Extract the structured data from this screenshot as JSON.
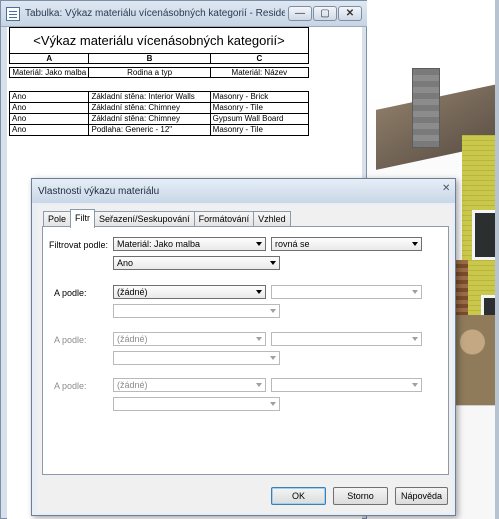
{
  "schedule_window": {
    "title": "Tabulka: Výkaz materiálu vícenásobných kategorií - Residential_...",
    "min_label": "—",
    "max_label": "▢",
    "close_label": "✕",
    "sheet_title": "<Výkaz materiálu vícenásobných kategorií>",
    "col_letters": [
      "A",
      "B",
      "C"
    ],
    "col_headers": [
      "Materiál: Jako malba",
      "Rodina a typ",
      "Materiál: Název"
    ],
    "rows": [
      [
        "Ano",
        "Základní stěna: Interior Walls",
        "Masonry - Brick"
      ],
      [
        "Ano",
        "Základní stěna: Chimney",
        "Masonry - Tile"
      ],
      [
        "Ano",
        "Základní stěna: Chimney",
        "Gypsum Wall Board"
      ],
      [
        "Ano",
        "Podlaha: Generic - 12\"",
        "Masonry - Tile"
      ]
    ]
  },
  "dialog": {
    "title": "Vlastnosti výkazu materiálu",
    "close_label": "✕",
    "tabs": [
      "Pole",
      "Filtr",
      "Seřazení/Seskupování",
      "Formátování",
      "Vzhled"
    ],
    "active_tab": "Filtr",
    "filter": {
      "label": "Filtrovat podle:",
      "field": "Materiál: Jako malba",
      "operator": "rovná se",
      "value": "Ano"
    },
    "and1": {
      "label": "A podle:",
      "field": "(žádné)",
      "operator": "",
      "value": ""
    },
    "and2": {
      "label": "A podle:",
      "field": "(žádné)",
      "operator": "",
      "value": ""
    },
    "and3": {
      "label": "A podle:",
      "field": "(žádné)",
      "operator": "",
      "value": ""
    },
    "buttons": {
      "ok": "OK",
      "cancel": "Storno",
      "help": "Nápověda"
    }
  }
}
